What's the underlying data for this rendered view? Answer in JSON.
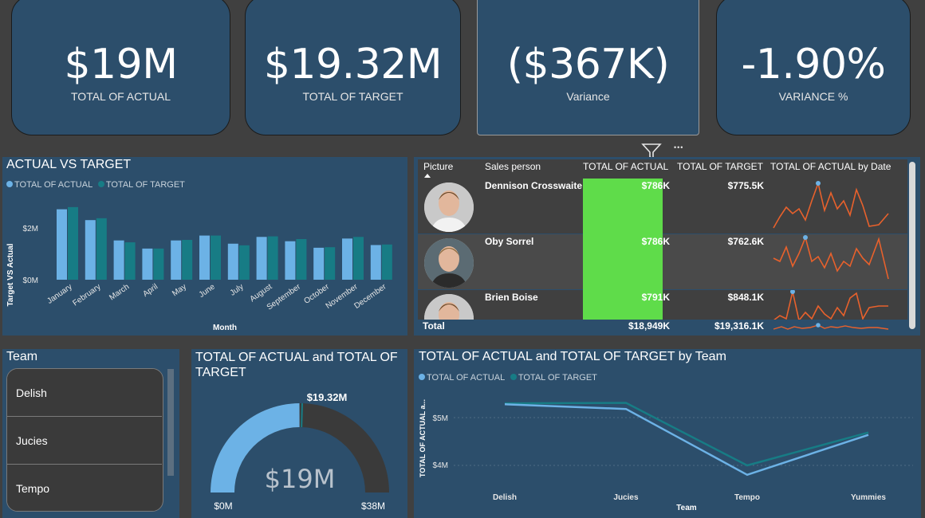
{
  "kpis": [
    {
      "value": "$19M",
      "label": "TOTAL OF ACTUAL"
    },
    {
      "value": "$19.32M",
      "label": "TOTAL OF TARGET"
    },
    {
      "value": "($367K)",
      "label": "Variance"
    },
    {
      "value": "-1.90%",
      "label": "VARIANCE %"
    }
  ],
  "toolbar": {
    "filter_icon": "filter-icon",
    "more_icon": "more-options-icon",
    "more_glyph": "•••"
  },
  "bar_chart": {
    "title": "ACTUAL VS TARGET",
    "legend": [
      "TOTAL OF ACTUAL",
      "TOTAL OF TARGET"
    ],
    "ylabel": "Target VS Actual",
    "xlabel": "Month",
    "yticks": [
      "$2M",
      "$0M"
    ],
    "colors": {
      "actual": "#6cb2e6",
      "target": "#177c85"
    }
  },
  "table": {
    "headers": [
      "Picture",
      "Sales person",
      "TOTAL OF ACTUAL",
      "TOTAL OF TARGET",
      "TOTAL OF ACTUAL by Date"
    ],
    "rows": [
      {
        "name": "Dennison Crosswaite",
        "actual": "$786K",
        "target": "$775.5K"
      },
      {
        "name": "Oby Sorrel",
        "actual": "$786K",
        "target": "$762.6K"
      },
      {
        "name": "Brien Boise",
        "actual": "$791K",
        "target": "$848.1K"
      }
    ],
    "total": {
      "label": "Total",
      "actual": "$18,949K",
      "target": "$19,316.1K"
    },
    "bar_color": "#5fdc4a",
    "spark_color": "#e8612c"
  },
  "team_slicer": {
    "title": "Team",
    "items": [
      "Delish",
      "Jucies",
      "Tempo"
    ]
  },
  "gauge": {
    "title": "TOTAL OF ACTUAL and TOTAL OF TARGET",
    "value_label": "$19M",
    "target_label": "$19.32M",
    "min_label": "$0M",
    "max_label": "$38M",
    "value": 18.949,
    "target": 19.32,
    "max": 38
  },
  "chart_data": [
    {
      "type": "bar",
      "title": "ACTUAL VS TARGET",
      "xlabel": "Month",
      "ylabel": "Target VS Actual",
      "categories": [
        "January",
        "February",
        "March",
        "April",
        "May",
        "June",
        "July",
        "August",
        "September",
        "October",
        "November",
        "December"
      ],
      "series": [
        {
          "name": "TOTAL OF ACTUAL",
          "values": [
            2.6,
            2.2,
            1.45,
            1.15,
            1.45,
            1.63,
            1.33,
            1.58,
            1.42,
            1.18,
            1.52,
            1.28
          ]
        },
        {
          "name": "TOTAL OF TARGET",
          "values": [
            2.68,
            2.27,
            1.38,
            1.15,
            1.47,
            1.63,
            1.27,
            1.6,
            1.5,
            1.2,
            1.58,
            1.3
          ]
        }
      ],
      "yticks": [
        0,
        2
      ],
      "ylim": [
        0,
        3.3
      ],
      "legend": "top-left"
    },
    {
      "type": "line",
      "title": "TOTAL OF ACTUAL and TOTAL OF TARGET by Team",
      "xlabel": "Team",
      "ylabel": "TOTAL OF ACTUAL a...",
      "categories": [
        "Delish",
        "Jucies",
        "Tempo",
        "Yummies"
      ],
      "series": [
        {
          "name": "TOTAL OF ACTUAL",
          "values": [
            5.3,
            5.2,
            3.8,
            4.65
          ]
        },
        {
          "name": "TOTAL OF TARGET",
          "values": [
            5.32,
            5.33,
            4.0,
            4.7
          ]
        }
      ],
      "yticks": [
        4,
        5
      ],
      "ylim": [
        3.5,
        5.6
      ],
      "legend": "top-left"
    }
  ],
  "team_line": {
    "title": "TOTAL OF ACTUAL and TOTAL OF TARGET by Team",
    "legend": [
      "TOTAL OF ACTUAL",
      "TOTAL OF TARGET"
    ],
    "ylabel": "TOTAL OF ACTUAL a...",
    "xlabel": "Team",
    "yticks": [
      "$5M",
      "$4M"
    ]
  }
}
